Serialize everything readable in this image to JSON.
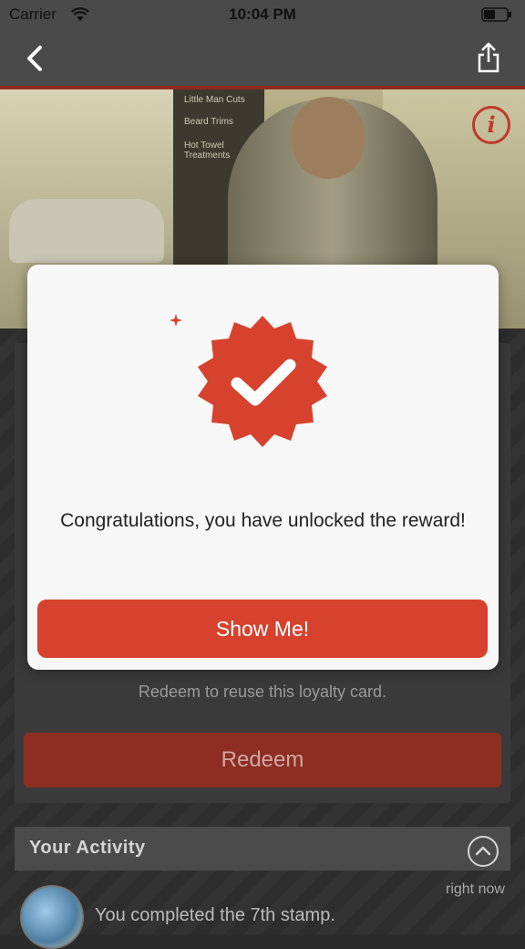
{
  "status_bar": {
    "carrier": "Carrier",
    "time": "10:04 PM"
  },
  "nav": {
    "back_icon": "chevron-left-icon",
    "share_icon": "share-icon"
  },
  "hero": {
    "info_icon": "info-icon",
    "info_glyph": "i",
    "sign_lines": [
      "Little Man Cuts",
      "Beard Trims",
      "Hot Towel Treatments"
    ]
  },
  "modal": {
    "badge_icon": "checkmark-badge-icon",
    "message": "Congratulations, you have unlocked the reward!",
    "button_label": "Show Me!"
  },
  "card": {
    "redeem_hint": "Redeem to reuse this loyalty card.",
    "redeem_label": "Redeem"
  },
  "activity": {
    "title": "Your Activity",
    "items": [
      {
        "text": "You completed the 7th stamp.",
        "time": "right now"
      }
    ]
  },
  "colors": {
    "accent": "#d6422e",
    "nav_bar": "#4a4a4a",
    "redeem_dim": "#8e2d22"
  }
}
